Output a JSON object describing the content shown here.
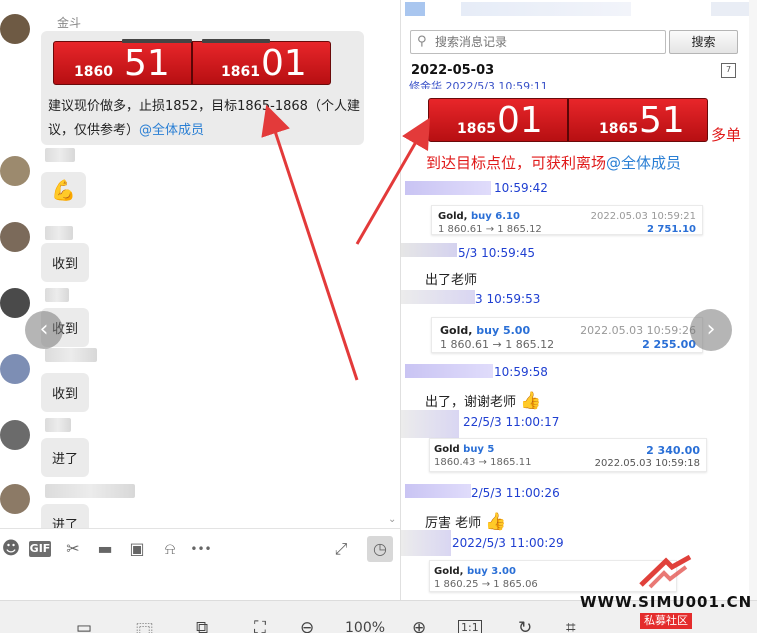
{
  "chat": {
    "sender_name": "金斗",
    "signal_panel": {
      "left_small": "1860",
      "left_big": "51",
      "right_small": "1861",
      "right_big": "01"
    },
    "advice_text": "建议现价做多，止损1852，目标1865-1868（个人建议，仅供参考）",
    "mention": "@全体成员",
    "messages": [
      "收到",
      "收到",
      "收到",
      "进了",
      "进了"
    ],
    "strong_emoji": "💪"
  },
  "toolbar": {
    "icons": [
      "emoji-icon",
      "gif-icon",
      "scissors-icon",
      "folder-icon",
      "image-icon",
      "bell-icon",
      "more-icon",
      "expand-icon",
      "clock-icon"
    ],
    "gif_label": "GIF",
    "more_label": "•••"
  },
  "history": {
    "search_placeholder": "搜索消息记录",
    "search_button": "搜索",
    "date": "2022-05-03",
    "cut_top": "修金华 2022/5/3 10:59:11",
    "target_panel": {
      "left_small": "1865",
      "left_big": "01",
      "right_small": "1865",
      "right_big": "51"
    },
    "target_label_1": "多单",
    "target_label_2": "到达目标点位，可获利离场",
    "target_mention": "@全体成员",
    "entries": [
      {
        "time": "10:59:42",
        "card": {
          "symbol": "Gold,",
          "side": "buy 6.10",
          "route": "1 860.61 → 1 865.12",
          "timestamp": "2022.05.03 10:59:21",
          "profit": "2 751.10"
        }
      },
      {
        "time": "5/3 10:59:45",
        "text": "出了老师"
      },
      {
        "time": "3 10:59:53",
        "card": {
          "symbol": "Gold,",
          "side": "buy 5.00",
          "route": "1 860.61 → 1 865.12",
          "timestamp": "2022.05.03 10:59:26",
          "profit": "2 255.00"
        }
      },
      {
        "time": "10:59:58",
        "text": "出了，谢谢老师"
      },
      {
        "time": "22/5/3 11:00:17",
        "card": {
          "symbol": "Gold",
          "side": "buy 5",
          "route": "1860.43 → 1865.11",
          "timestamp": "2022.05.03 10:59:18",
          "profit": "2 340.00"
        }
      },
      {
        "time": "2/5/3 11:00:26",
        "text": "厉害 老师"
      },
      {
        "time": "2022/5/3 11:00:29",
        "card": {
          "symbol": "Gold,",
          "side": "buy 3.00",
          "route": "1 860.25 → 1 865.06",
          "timestamp": "",
          "profit": ""
        }
      }
    ],
    "thumb_emoji": "👍"
  },
  "viewer": {
    "zoom": "100%",
    "actual_size": "1:1"
  },
  "watermark": {
    "text": "WWW.SIMU001.CN",
    "sub": "私募社区"
  },
  "colors": {
    "signal_red": "#d8151b",
    "mention_blue": "#2a7fd4",
    "history_time_blue": "#1f3fd1",
    "arrow_red": "#e33a3a"
  }
}
